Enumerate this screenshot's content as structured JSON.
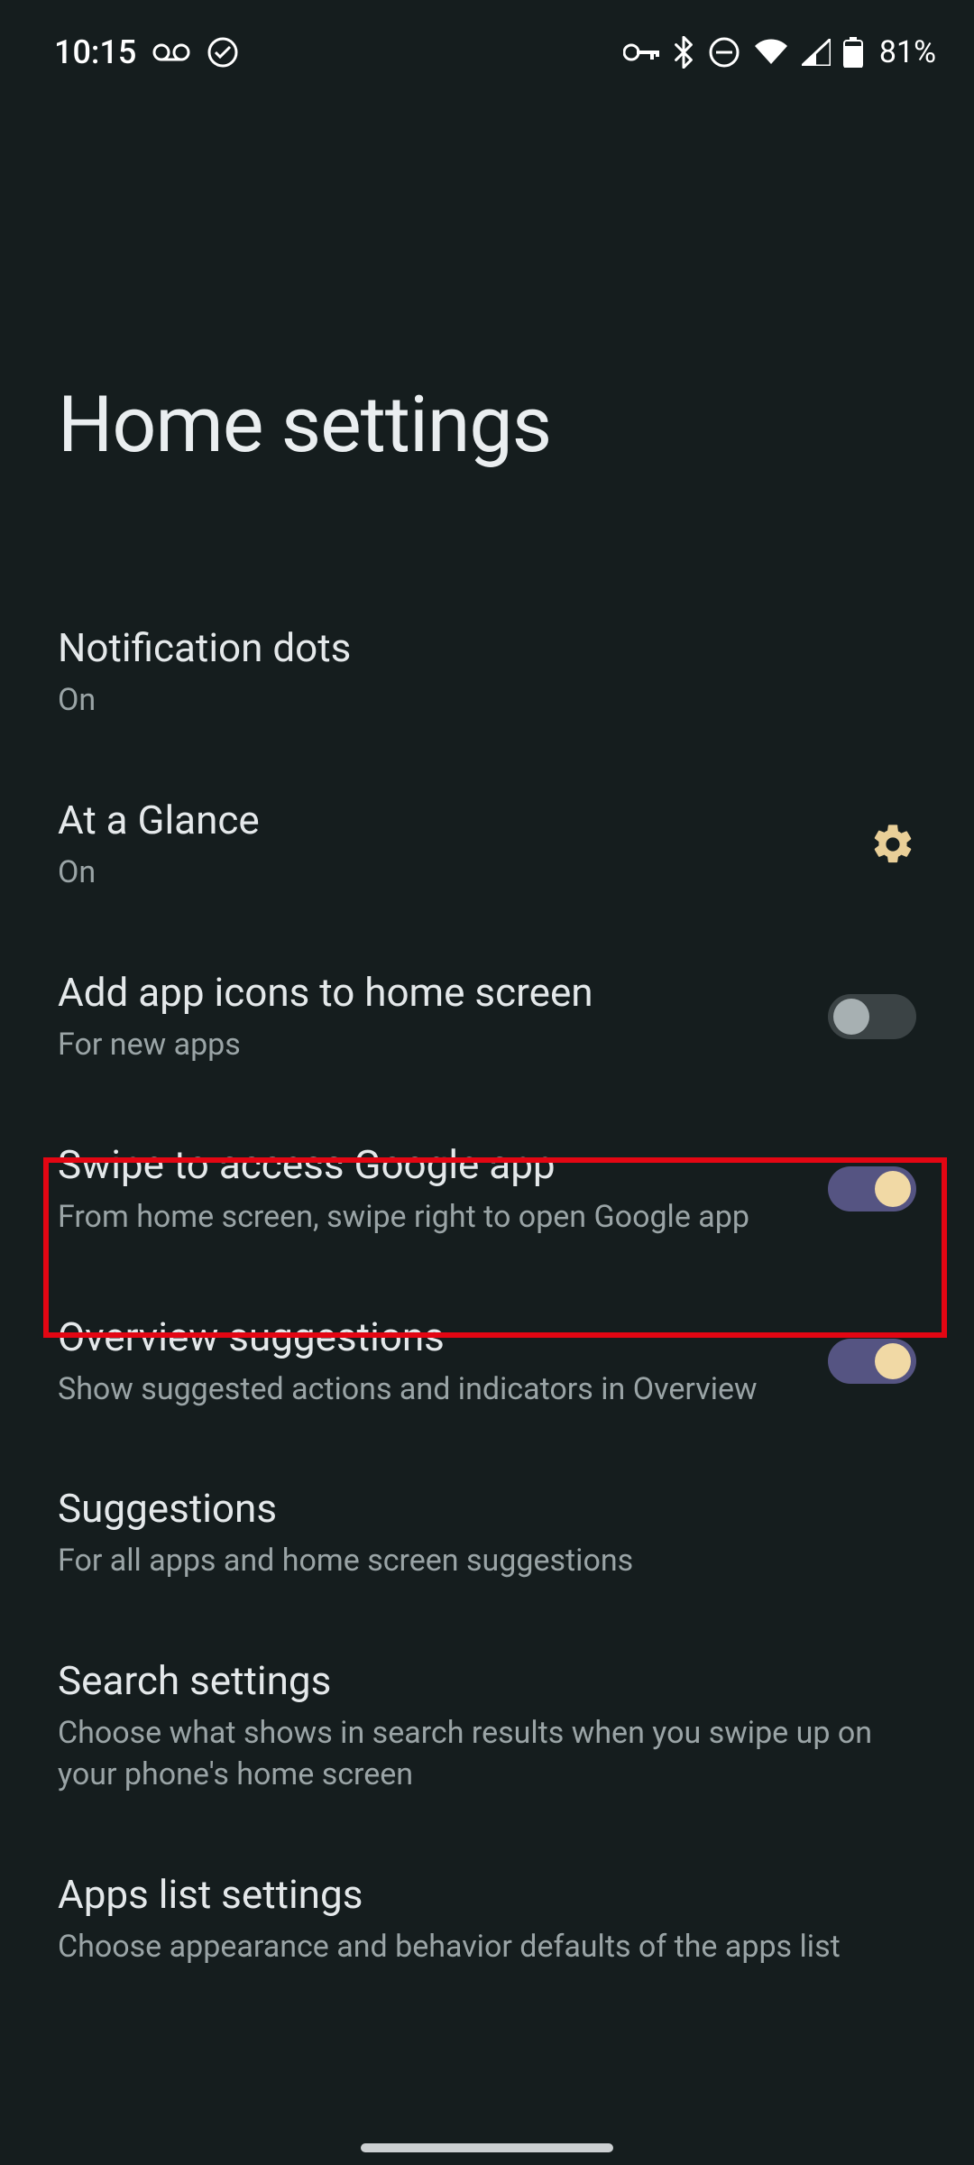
{
  "status": {
    "time": "10:15",
    "battery_pct": "81%"
  },
  "page": {
    "title": "Home settings"
  },
  "settings": {
    "notification_dots": {
      "title": "Notification dots",
      "subtitle": "On"
    },
    "at_a_glance": {
      "title": "At a Glance",
      "subtitle": "On"
    },
    "add_icons": {
      "title": "Add app icons to home screen",
      "subtitle": "For new apps"
    },
    "swipe_google": {
      "title": "Swipe to access Google app",
      "subtitle": "From home screen, swipe right to open Google app"
    },
    "overview_suggestions": {
      "title": "Overview suggestions",
      "subtitle": "Show suggested actions and indicators in Overview"
    },
    "suggestions": {
      "title": "Suggestions",
      "subtitle": "For all apps and home screen suggestions"
    },
    "search_settings": {
      "title": "Search settings",
      "subtitle": "Choose what shows in search results when you swipe up on your phone's home screen"
    },
    "apps_list": {
      "title": "Apps list settings",
      "subtitle": "Choose appearance and behavior defaults of the apps list"
    }
  }
}
